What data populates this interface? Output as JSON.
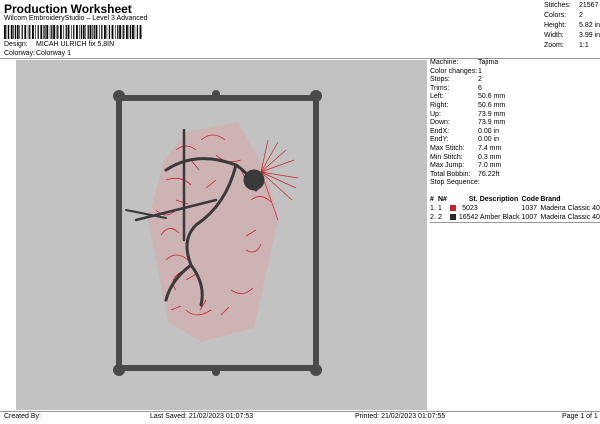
{
  "header": {
    "title": "Production Worksheet",
    "subtitle": "Wilcom EmbroideryStudio – Level 3 Advanced",
    "barcode_suffix": ",",
    "design_label": "Design:",
    "design_value": "MICAH ULRICH fix 5,8IN",
    "colorway_label": "Colorway:",
    "colorway_value": "Colorway 1"
  },
  "stats": [
    {
      "label": "Stitches:",
      "value": "21567"
    },
    {
      "label": "Colors:",
      "value": "2"
    },
    {
      "label": "Height:",
      "value": "5.82 in"
    },
    {
      "label": "Width:",
      "value": "3.99 in"
    },
    {
      "label": "Zoom:",
      "value": "1:1"
    }
  ],
  "machine_info": [
    {
      "label": "Machine:",
      "value": "Tajima"
    },
    {
      "label": "Color changes:",
      "value": "1"
    },
    {
      "label": "Stops:",
      "value": "2"
    },
    {
      "label": "Trims:",
      "value": "6"
    },
    {
      "label": "Left:",
      "value": "50.6 mm"
    },
    {
      "label": "Right:",
      "value": "50.6 mm"
    },
    {
      "label": "Up:",
      "value": "73.9 mm"
    },
    {
      "label": "Down:",
      "value": "73.9 mm"
    },
    {
      "label": "EndX:",
      "value": "0.00 in"
    },
    {
      "label": "EndY:",
      "value": "0.00 in"
    },
    {
      "label": "Max Stitch:",
      "value": "7.4 mm"
    },
    {
      "label": "Min Stitch:",
      "value": "0.3 mm"
    },
    {
      "label": "Max Jump:",
      "value": "7.0 mm"
    },
    {
      "label": "Total Bobbin:",
      "value": "76.22ft"
    }
  ],
  "stop_sequence": {
    "label": "Stop Sequence:",
    "columns": [
      "#",
      "N#",
      "",
      "St.",
      "Description",
      "Code",
      "Brand"
    ],
    "rows": [
      {
        "num": "1.",
        "n": "1",
        "color": "#c8222b",
        "st": "5023",
        "desc": "",
        "code": "1037",
        "brand": "Madeira Classic 40"
      },
      {
        "num": "2.",
        "n": "2",
        "color": "#2a2a2a",
        "st": "16542",
        "desc": "Amber Black",
        "code": "1007",
        "brand": "Madeira Classic 40"
      }
    ]
  },
  "footer": {
    "created_by": "Created By:",
    "last_saved": "Last Saved: 21/02/2023 01:07:53",
    "printed": "Printed: 21/02/2023 01:07:55",
    "page": "Page 1 of 1"
  },
  "colors": {
    "design_bg": "#c2c2c2",
    "thread_red": "#c8222b",
    "thread_black": "#2a2a2a"
  }
}
